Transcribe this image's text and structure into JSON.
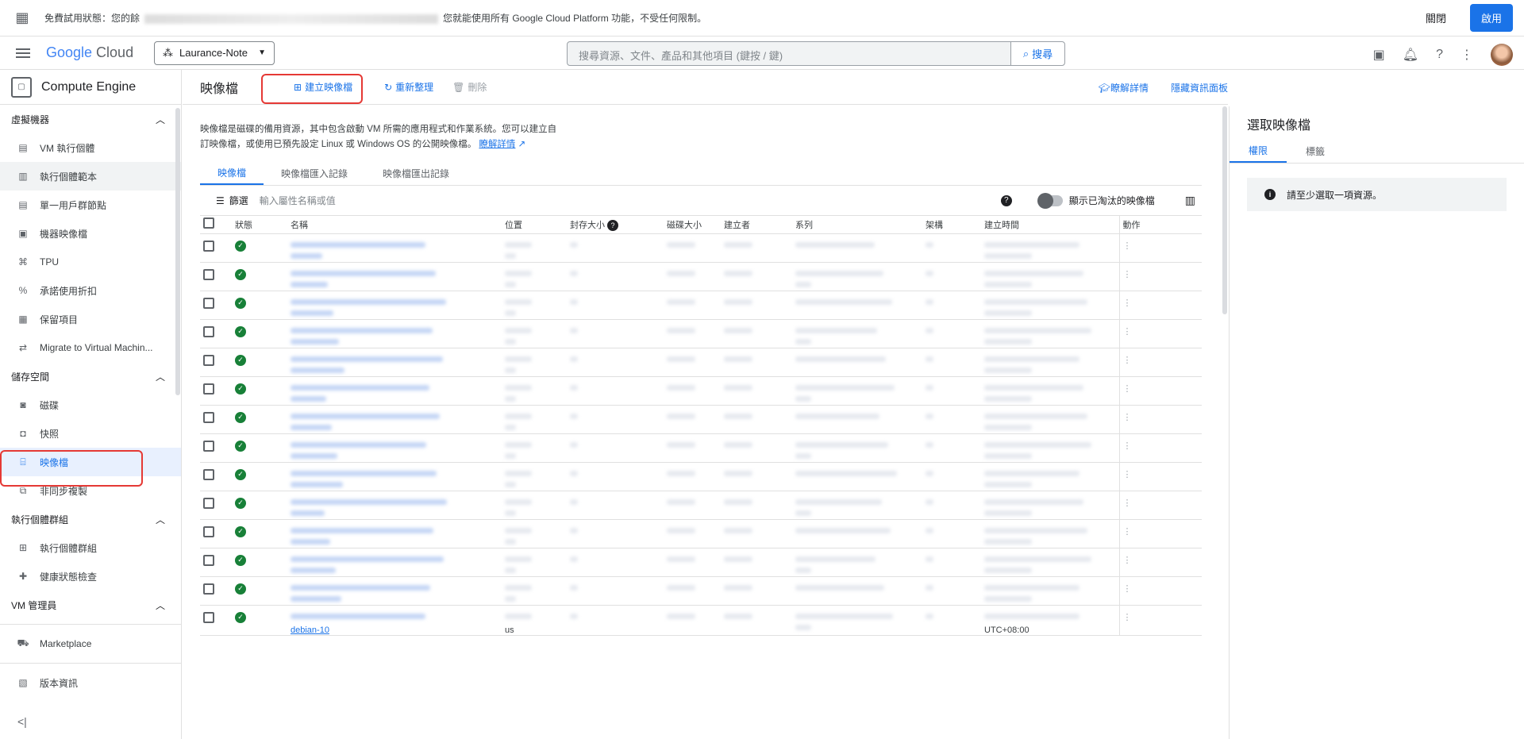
{
  "topbar": {
    "trial_prefix": "免費試用狀態：您的餘",
    "trial_suffix": "您就能使用所有 Google Cloud Platform 功能，不受任何限制。",
    "close_label": "關閉",
    "activate_label": "啟用"
  },
  "header": {
    "logo_google": "Google",
    "logo_cloud": " Cloud",
    "project_name": "Laurance-Note",
    "search_placeholder": "搜尋資源、文件、產品和其他項目 (鍵按 / 鍵)",
    "search_button": "搜尋"
  },
  "sidebar": {
    "title": "Compute Engine",
    "sections": [
      {
        "label": "虛擬機器",
        "items": [
          "VM 執行個體",
          "執行個體範本",
          "單一用戶群節點",
          "機器映像檔",
          "TPU",
          "承諾使用折扣",
          "保留項目",
          "Migrate to Virtual Machin..."
        ]
      },
      {
        "label": "儲存空間",
        "items": [
          "磁碟",
          "快照",
          "映像檔",
          "非同步複製"
        ]
      },
      {
        "label": "執行個體群組",
        "items": [
          "執行個體群組",
          "健康狀態檢查"
        ]
      },
      {
        "label": "VM 管理員",
        "items": []
      }
    ],
    "bottom_items": [
      "Marketplace",
      "版本資訊"
    ]
  },
  "toolbar": {
    "title": "映像檔",
    "create_label": "建立映像檔",
    "refresh_label": "重新整理",
    "delete_label": "刪除",
    "learn_label": "瞭解詳情",
    "hide_panel_label": "隱藏資訊面板"
  },
  "description": {
    "text": "映像檔是磁碟的備用資源，其中包含啟動 VM 所需的應用程式和作業系統。您可以建立自訂映像檔，或使用已預先設定 Linux 或 Windows OS 的公開映像檔。",
    "link": "瞭解詳情"
  },
  "tabs": [
    "映像檔",
    "映像檔匯入記錄",
    "映像檔匯出記錄"
  ],
  "filter": {
    "label": "篩選",
    "placeholder": "輸入屬性名稱或值",
    "toggle_label": "顯示已淘汰的映像檔"
  },
  "table": {
    "headers": [
      "狀態",
      "名稱",
      "位置",
      "封存大小",
      "磁碟大小",
      "建立者",
      "系列",
      "架構",
      "建立時間",
      "動作"
    ],
    "visible_row": {
      "name": "debian-10",
      "location": "us",
      "created": "UTC+08:00"
    },
    "row_count": 14
  },
  "panel": {
    "title": "選取映像檔",
    "tabs": [
      "權限",
      "標籤"
    ],
    "message": "請至少選取一項資源。"
  }
}
